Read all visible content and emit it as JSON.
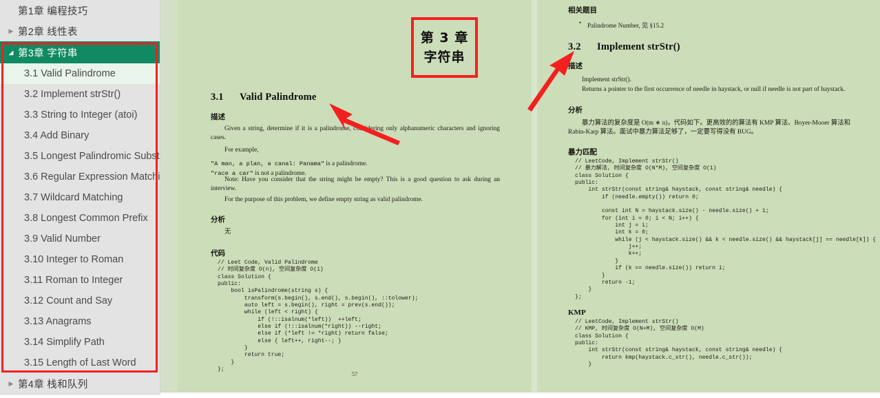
{
  "sidebar": {
    "chapters": [
      {
        "label": "第1章  编程技巧",
        "caret": "",
        "state": "collapsed-nocaret"
      },
      {
        "label": "第2章  线性表",
        "caret": "▶",
        "state": "collapsed"
      },
      {
        "label": "第3章  字符串",
        "caret": "◢",
        "state": "expanded-active"
      },
      {
        "label": "第4章  栈和队列",
        "caret": "▶",
        "state": "collapsed"
      }
    ],
    "sections": [
      "3.1 Valid Palindrome",
      "3.2 Implement strStr()",
      "3.3 String to Integer (atoi)",
      "3.4 Add Binary",
      "3.5 Longest Palindromic Subst...",
      "3.6 Regular Expression Matchi...",
      "3.7 Wildcard Matching",
      "3.8 Longest Common Prefix",
      "3.9 Valid Number",
      "3.10 Integer to Roman",
      "3.11 Roman to Integer",
      "3.12 Count and Say",
      "3.13 Anagrams",
      "3.14 Simplify Path",
      "3.15 Length of Last Word"
    ],
    "selected_section": "3.1 Valid Palindrome",
    "active_chapter": "第3章  字符串",
    "accent_color": "#0f8a62",
    "selected_bg": "#e9f5ea",
    "highlight_color": "#f42020"
  },
  "annotations": {
    "chapter_box": {
      "line1": "第 3 章",
      "line2": "字符串",
      "border_color": "#f42020"
    },
    "arrow_color": "#f42020",
    "arrow_left_target": "3.1  Valid Palindrome",
    "arrow_right_target": "3.2  Implement strStr()"
  },
  "left_page": {
    "page_number": "57",
    "section": {
      "number": "3.1",
      "title": "Valid Palindrome"
    },
    "heading_desc": "描述",
    "desc_paragraphs": [
      "Given a string, determine if it is a palindrome, considering only alphanumeric characters and ignoring cases.",
      "For example,"
    ],
    "example_lines": [
      {
        "mono": "\"A man, a plan, a canal: Panama\"",
        "rest": " is a palindrome."
      },
      {
        "mono": "\"race a car\"",
        "rest": " is not a palindrome."
      }
    ],
    "note_paragraph": "Note:  Have you consider that the string might be empty?  This is a good question to ask during an interview.",
    "purpose_paragraph": "For the purpose of this problem, we define empty string as valid palindrome.",
    "heading_analysis": "分析",
    "analysis_text": "无",
    "heading_code": "代码",
    "code": "// Leet Code, Valid Palindrome\n// 时间复杂度 O(n), 空间复杂度 O(1)\nclass Solution {\npublic:\n    bool isPalindrome(string s) {\n        transform(s.begin(), s.end(), s.begin(), ::tolower);\n        auto left = s.begin(), right = prev(s.end());\n        while (left < right) {\n            if (!::isalnum(*left))  ++left;\n            else if (!::isalnum(*right)) --right;\n            else if (*left != *right) return false;\n            else { left++, right--; }\n        }\n        return true;\n    }\n};"
  },
  "right_page": {
    "heading_related": "相关题目",
    "related_items": [
      "Palindrome Number, 见 §15.2"
    ],
    "section": {
      "number": "3.2",
      "title": "Implement strStr()"
    },
    "heading_desc": "描述",
    "desc_lines": [
      "Implement strStr().",
      "Returns a pointer to the first occurrence of needle in haystack, or null if needle is not part of haystack."
    ],
    "heading_analysis": "分析",
    "analysis_paragraph": "暴力算法的复杂度是 O(m ∗ n)，代码如下。更高效的的算法有 KMP 算法、Boyer-Mooer 算法和 Rabin-Karp 算法。面试中暴力算法足够了，一定要写得没有 BUG。",
    "heading_brute": "暴力匹配",
    "code_brute": "// LeetCode, Implement strStr()\n// 暴力解法, 时间复杂度 O(N*M), 空间复杂度 O(1)\nclass Solution {\npublic:\n    int strStr(const string& haystack, const string& needle) {\n        if (needle.empty()) return 0;\n\n        const int N = haystack.size() - needle.size() + 1;\n        for (int i = 0; i < N; i++) {\n            int j = i;\n            int k = 0;\n            while (j < haystack.size() && k < needle.size() && haystack[j] == needle[k]) {\n                j++;\n                k++;\n            }\n            if (k == needle.size()) return i;\n        }\n        return -1;\n    }\n};",
    "heading_kmp": "KMP",
    "code_kmp": "// LeetCode, Implement strStr()\n// KMP, 时间复杂度 O(N+M), 空间复杂度 O(M)\nclass Solution {\npublic:\n    int strStr(const string& haystack, const string& needle) {\n        return kmp(haystack.c_str(), needle.c_str());\n    }"
  }
}
